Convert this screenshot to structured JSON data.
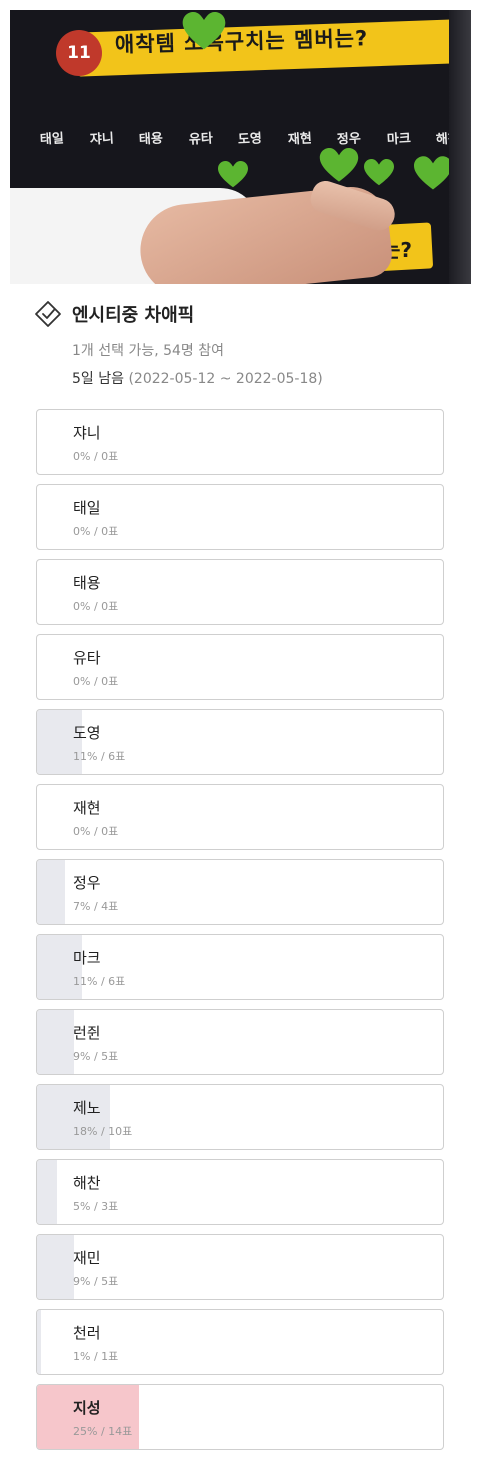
{
  "photo": {
    "badge_number": "11",
    "banner_text": "애착템 쏘옥구치는 멤버는?",
    "members": [
      "태일",
      "쟈니",
      "태용",
      "유타",
      "도영",
      "재현",
      "정우",
      "마크",
      "해찬"
    ],
    "bottom_sign_text": "는?",
    "colors": {
      "board": "#16161c",
      "banner": "#f2c41a",
      "heart": "#5cb531"
    }
  },
  "poll": {
    "title": "엔시티중 차애픽",
    "meta": "1개 선택 가능, 54명 참여",
    "remaining": "5일 남음",
    "date_range": "(2022-05-12 ~ 2022-05-18)",
    "options": [
      {
        "name": "쟈니",
        "stats": "0% / 0표",
        "percent": 0
      },
      {
        "name": "태일",
        "stats": "0% / 0표",
        "percent": 0
      },
      {
        "name": "태용",
        "stats": "0% / 0표",
        "percent": 0
      },
      {
        "name": "유타",
        "stats": "0% / 0표",
        "percent": 0
      },
      {
        "name": "도영",
        "stats": "11% / 6표",
        "percent": 11
      },
      {
        "name": "재현",
        "stats": "0% / 0표",
        "percent": 0
      },
      {
        "name": "정우",
        "stats": "7% / 4표",
        "percent": 7
      },
      {
        "name": "마크",
        "stats": "11% / 6표",
        "percent": 11
      },
      {
        "name": "런쥔",
        "stats": "9% / 5표",
        "percent": 9
      },
      {
        "name": "제노",
        "stats": "18% / 10표",
        "percent": 18
      },
      {
        "name": "해찬",
        "stats": "5% / 3표",
        "percent": 5
      },
      {
        "name": "재민",
        "stats": "9% / 5표",
        "percent": 9
      },
      {
        "name": "천러",
        "stats": "1% / 1표",
        "percent": 1
      },
      {
        "name": "지성",
        "stats": "25% / 14표",
        "percent": 25,
        "top": true
      }
    ],
    "colors": {
      "fill": "#e8e9ee",
      "top_fill": "#f6c6cb",
      "border": "#cfcfcf"
    }
  }
}
